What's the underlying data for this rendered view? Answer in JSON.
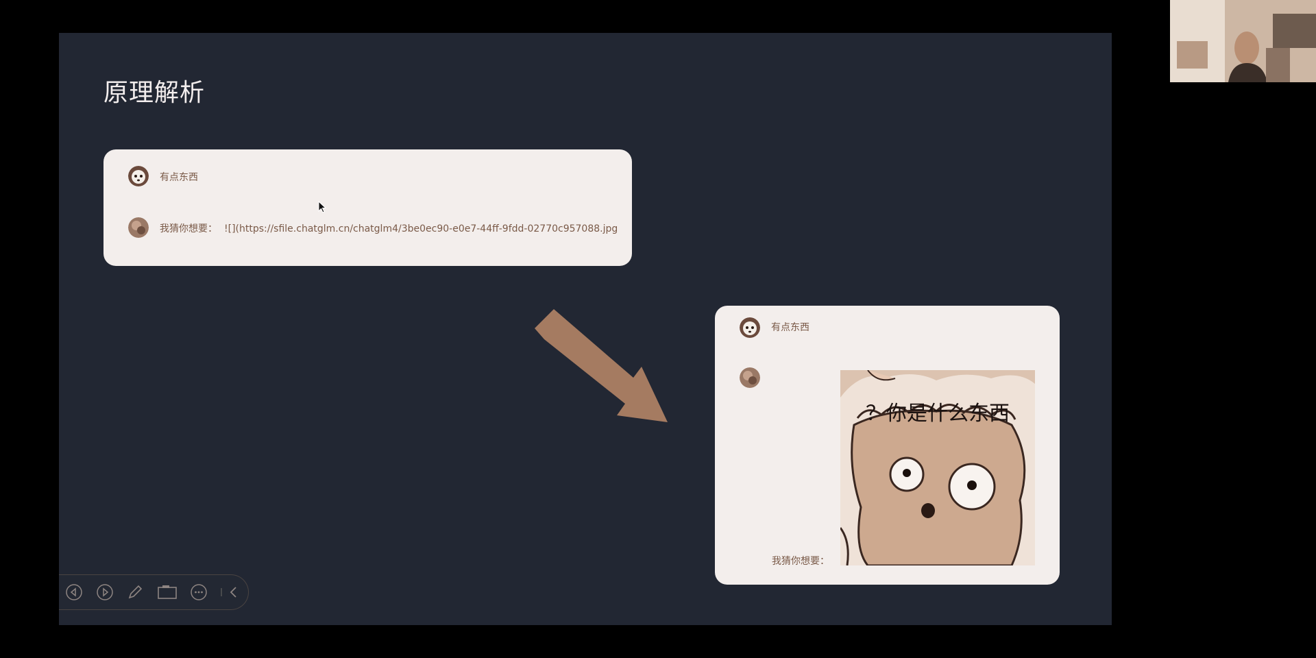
{
  "slide": {
    "title": "原理解析"
  },
  "card_top": {
    "user_name": "有点东西",
    "reply_prefix": "我猜你想要：",
    "reply_link": "![](https://sfile.chatglm.cn/chatglm4/3be0ec90-e0e7-44ff-9fdd-02770c957088.jpg"
  },
  "card_bottom": {
    "user_name": "有点东西",
    "reply_prefix": "我猜你想要：",
    "image_caption": "？你是什么东西"
  },
  "toolbar": {
    "icons": [
      "prev-icon",
      "next-icon",
      "pen-icon",
      "camera-icon",
      "more-icon",
      "collapse-icon"
    ]
  },
  "colors": {
    "slide_bg": "#222733",
    "card_bg": "#f3eeec",
    "arrow": "#a57b61",
    "text_brown": "#7a5a48"
  }
}
